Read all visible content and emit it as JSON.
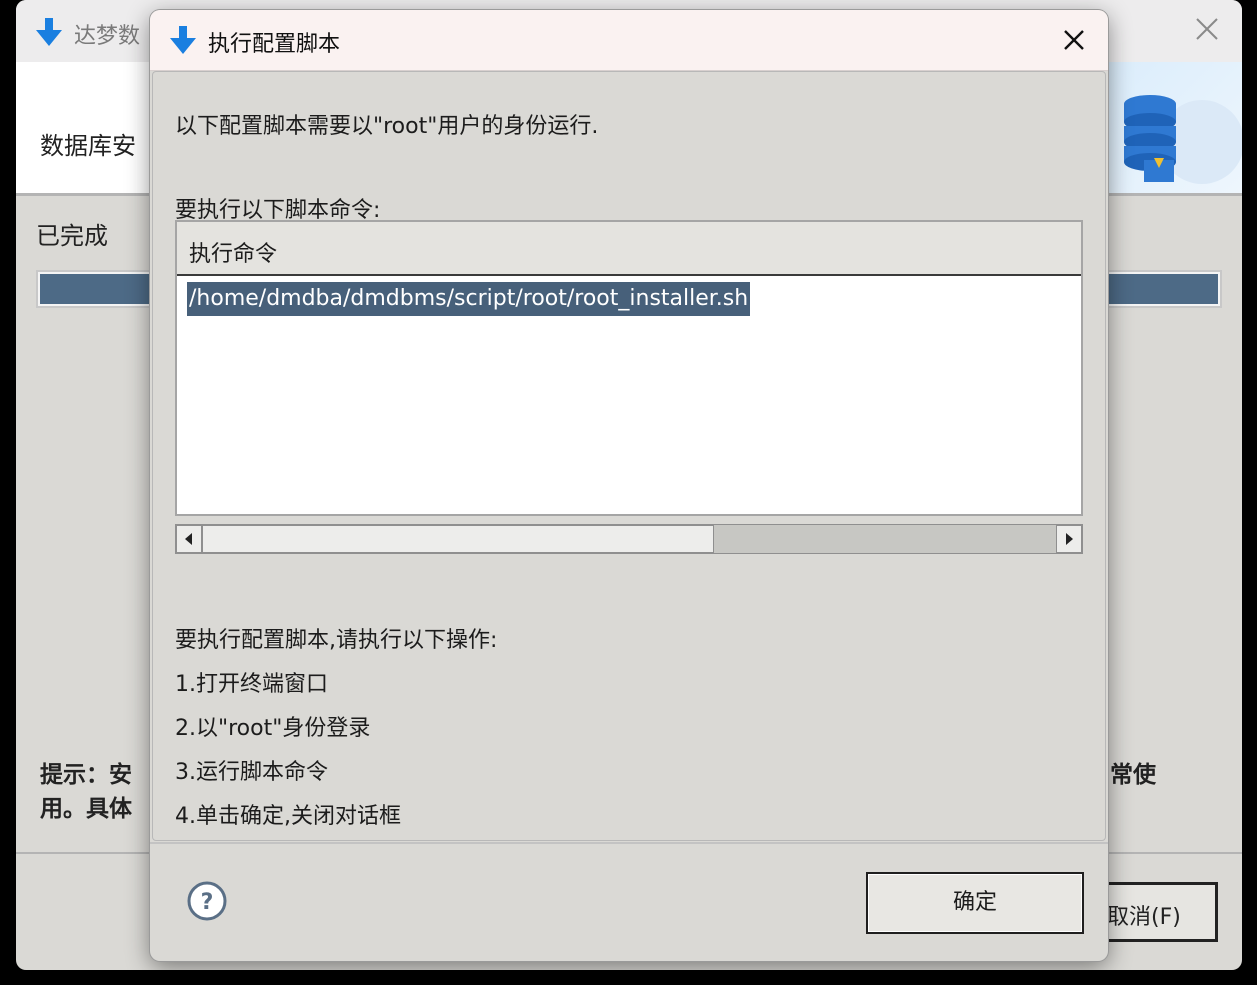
{
  "background_window": {
    "title": "达梦数",
    "banner_text": "数据库安",
    "progress_label": "已完成",
    "progress": 1.0,
    "hint_line1": "提示：安",
    "hint_line1_tail": "常使",
    "hint_line2": "用。具体",
    "cancel_label": "取消(F)"
  },
  "dialog": {
    "title": "执行配置脚本",
    "intro": "以下配置脚本需要以\"root\"用户的身份运行.",
    "commands_heading": "要执行以下脚本命令:",
    "table": {
      "column_header": "执行命令",
      "rows": [
        "/home/dmdba/dmdbms/script/root/root_installer.sh"
      ]
    },
    "steps_heading": "要执行配置脚本,请执行以下操作:",
    "steps": [
      "1.打开终端窗口",
      "2.以\"root\"身份登录",
      "3.运行脚本命令",
      "4.单击确定,关闭对话框"
    ],
    "ok_label": "确定"
  },
  "icons": {
    "title_icon": "download-arrow-icon",
    "close": "close-icon",
    "help": "help-icon"
  },
  "colors": {
    "accent_arrow": "#1a7fe0",
    "selection": "#47607a",
    "progress_fill": "#4d6a86"
  }
}
